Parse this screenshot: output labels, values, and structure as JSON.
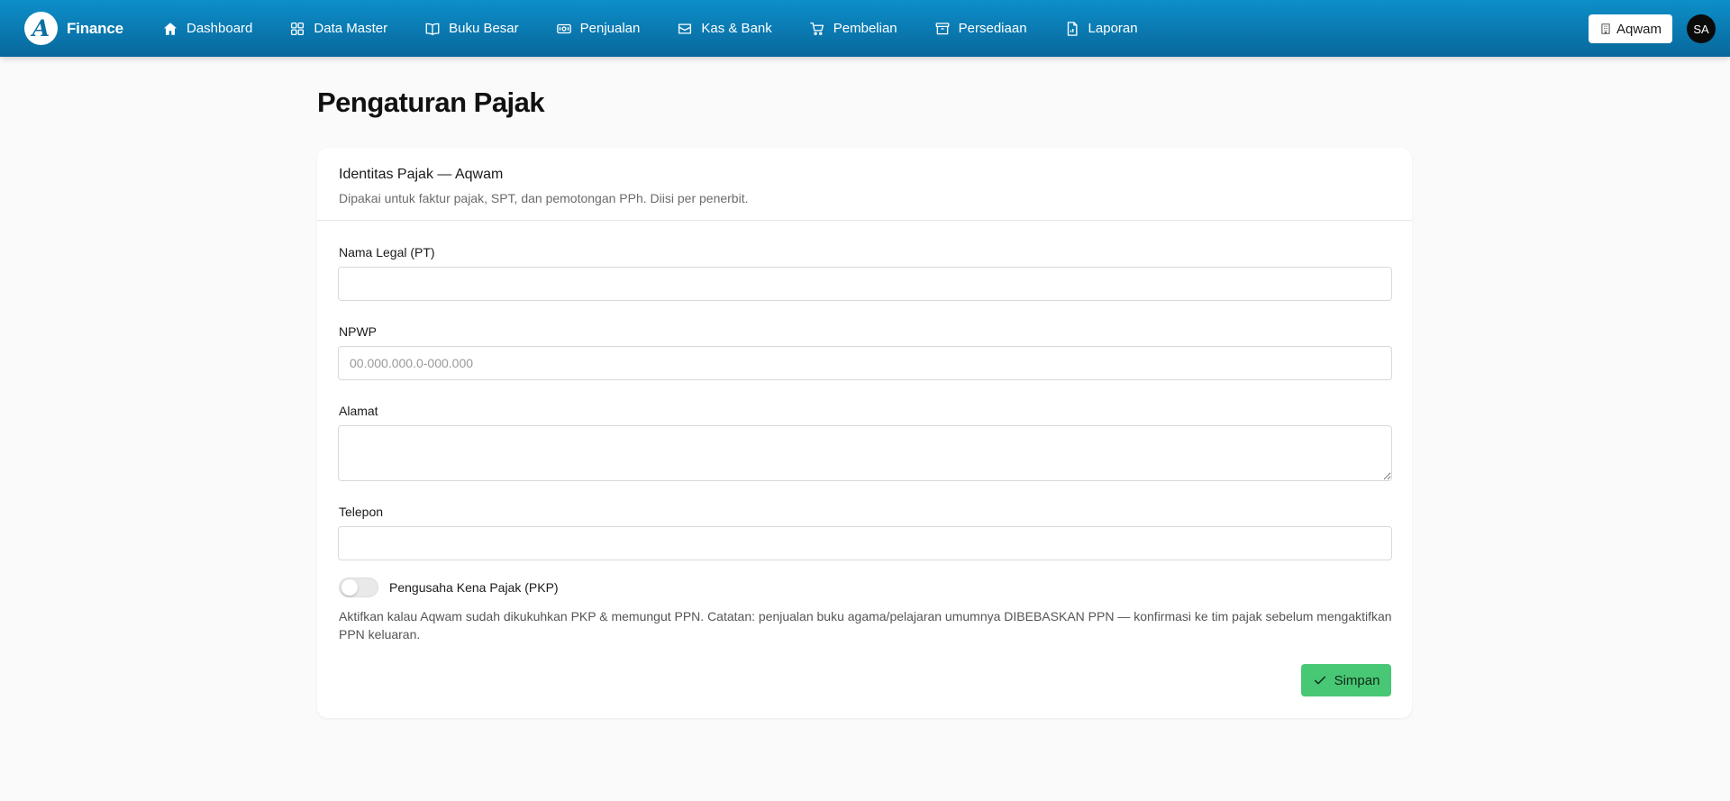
{
  "brand": {
    "logo_letter": "A",
    "name": "Finance"
  },
  "nav": {
    "items": [
      {
        "label": "Dashboard",
        "icon": "home-icon"
      },
      {
        "label": "Data Master",
        "icon": "grid-icon"
      },
      {
        "label": "Buku Besar",
        "icon": "book-icon"
      },
      {
        "label": "Penjualan",
        "icon": "banknote-icon"
      },
      {
        "label": "Kas & Bank",
        "icon": "wallet-icon"
      },
      {
        "label": "Pembelian",
        "icon": "cart-icon"
      },
      {
        "label": "Persediaan",
        "icon": "archive-icon"
      },
      {
        "label": "Laporan",
        "icon": "report-icon"
      }
    ]
  },
  "header": {
    "org_label": "Aqwam",
    "org_icon": "building-icon",
    "avatar_initials": "SA"
  },
  "page": {
    "title": "Pengaturan Pajak"
  },
  "card": {
    "title": "Identitas Pajak — Aqwam",
    "subtitle": "Dipakai untuk faktur pajak, SPT, dan pemotongan PPh. Diisi per penerbit."
  },
  "form": {
    "legal_name": {
      "label": "Nama Legal (PT)",
      "value": "",
      "placeholder": ""
    },
    "npwp": {
      "label": "NPWP",
      "value": "",
      "placeholder": "00.000.000.0-000.000"
    },
    "address": {
      "label": "Alamat",
      "value": "",
      "placeholder": ""
    },
    "phone": {
      "label": "Telepon",
      "value": "",
      "placeholder": ""
    },
    "pkp": {
      "label": "Pengusaha Kena Pajak (PKP)",
      "enabled": false,
      "help": "Aktifkan kalau Aqwam sudah dikukuhkan PKP & memungut PPN. Catatan: penjualan buku agama/pelajaran umumnya DIBEBASKAN PPN — konfirmasi ke tim pajak sebelum mengaktifkan PPN keluaran."
    },
    "save_label": "Simpan"
  },
  "colors": {
    "topbar": "#0a79b0",
    "save_button": "#48c774",
    "page_background": "#fafafa"
  }
}
